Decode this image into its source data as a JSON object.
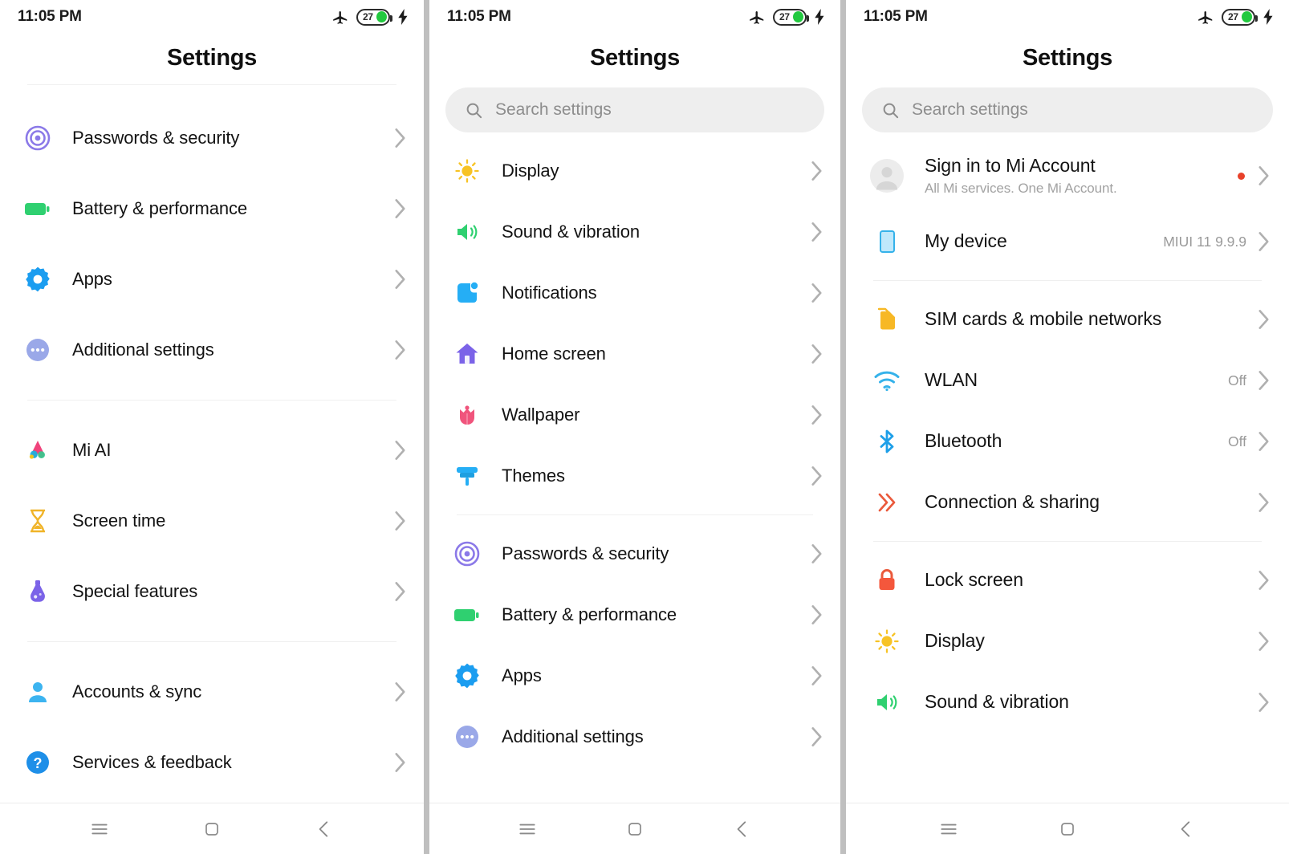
{
  "status_bar": {
    "time": "11:05 PM",
    "airplane_icon": "airplane-mode-icon",
    "battery_level": "27",
    "charging_icon": "lightning-bolt-icon"
  },
  "nav_bar": {
    "menu_label": "menu-icon",
    "home_label": "home-square-icon",
    "back_label": "back-chevron-icon"
  },
  "search": {
    "placeholder": "Search settings",
    "icon": "search-icon"
  },
  "colors": {
    "accent_green": "#22c93f",
    "badge_red": "#e8412a",
    "chevron_gray": "#b0b0b0",
    "value_gray": "#9a9a9a"
  },
  "panel1": {
    "title": "Settings",
    "groups": [
      {
        "items": [
          {
            "label": "Passwords & security",
            "icon": "fingerprint-icon",
            "value": ""
          },
          {
            "label": "Battery & performance",
            "icon": "battery-icon",
            "value": ""
          },
          {
            "label": "Apps",
            "icon": "gear-icon",
            "value": ""
          },
          {
            "label": "Additional settings",
            "icon": "more-dots-icon",
            "value": ""
          }
        ]
      },
      {
        "items": [
          {
            "label": "Mi AI",
            "icon": "mi-ai-icon",
            "value": ""
          },
          {
            "label": "Screen time",
            "icon": "hourglass-icon",
            "value": ""
          },
          {
            "label": "Special features",
            "icon": "flask-icon",
            "value": ""
          }
        ]
      },
      {
        "items": [
          {
            "label": "Accounts & sync",
            "icon": "person-icon",
            "value": ""
          },
          {
            "label": "Services & feedback",
            "icon": "question-circle-icon",
            "value": ""
          }
        ]
      }
    ]
  },
  "panel2": {
    "title": "Settings",
    "groups": [
      {
        "items": [
          {
            "label": "Display",
            "icon": "sun-icon",
            "value": ""
          },
          {
            "label": "Sound & vibration",
            "icon": "speaker-icon",
            "value": ""
          },
          {
            "label": "Notifications",
            "icon": "notification-square-icon",
            "value": ""
          },
          {
            "label": "Home screen",
            "icon": "house-icon",
            "value": ""
          },
          {
            "label": "Wallpaper",
            "icon": "tulip-icon",
            "value": ""
          },
          {
            "label": "Themes",
            "icon": "paintbrush-icon",
            "value": ""
          }
        ]
      },
      {
        "items": [
          {
            "label": "Passwords & security",
            "icon": "fingerprint-icon",
            "value": ""
          },
          {
            "label": "Battery & performance",
            "icon": "battery-icon",
            "value": ""
          },
          {
            "label": "Apps",
            "icon": "gear-icon",
            "value": ""
          },
          {
            "label": "Additional settings",
            "icon": "more-dots-icon",
            "value": ""
          }
        ]
      }
    ]
  },
  "panel3": {
    "title": "Settings",
    "account": {
      "label": "Sign in to Mi Account",
      "sublabel": "All Mi services. One Mi Account.",
      "icon": "avatar-icon",
      "has_badge": true
    },
    "groups": [
      {
        "items": [
          {
            "label": "My device",
            "icon": "device-icon",
            "value": "MIUI 11 9.9.9"
          }
        ]
      },
      {
        "items": [
          {
            "label": "SIM cards & mobile networks",
            "icon": "sim-card-icon",
            "value": ""
          },
          {
            "label": "WLAN",
            "icon": "wifi-icon",
            "value": "Off"
          },
          {
            "label": "Bluetooth",
            "icon": "bluetooth-icon",
            "value": "Off"
          },
          {
            "label": "Connection & sharing",
            "icon": "connection-sharing-icon",
            "value": ""
          }
        ]
      },
      {
        "items": [
          {
            "label": "Lock screen",
            "icon": "lock-icon",
            "value": ""
          },
          {
            "label": "Display",
            "icon": "sun-icon",
            "value": ""
          },
          {
            "label": "Sound & vibration",
            "icon": "speaker-icon",
            "value": ""
          }
        ]
      }
    ]
  }
}
